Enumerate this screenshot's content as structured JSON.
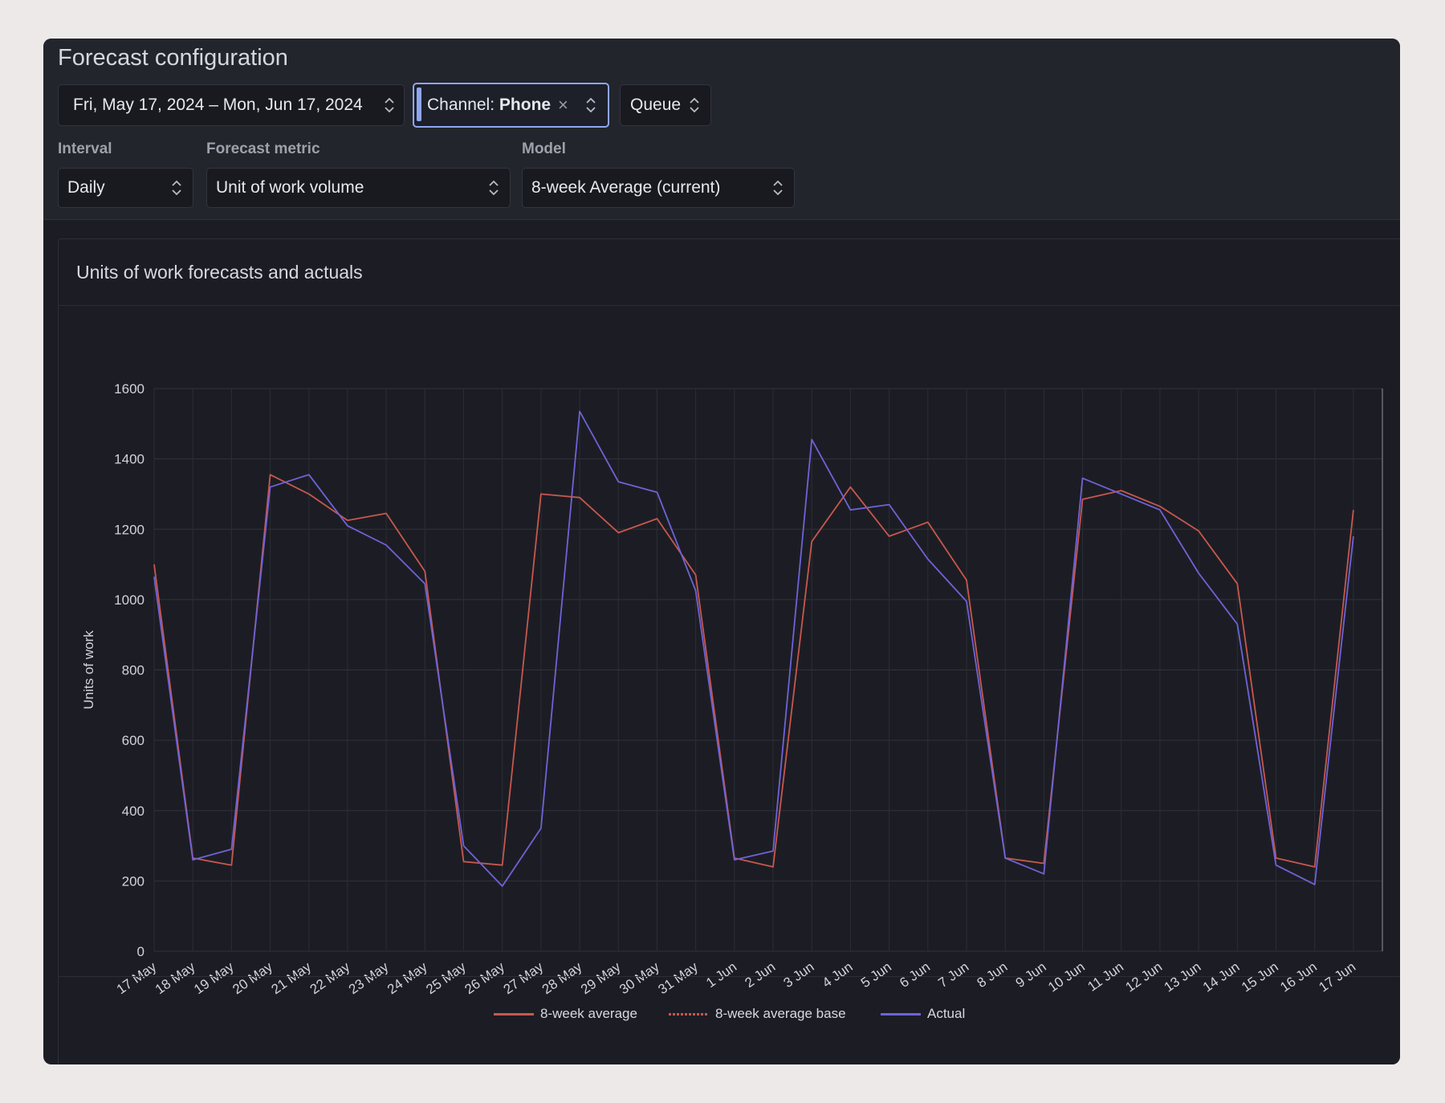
{
  "app": {
    "title": "Forecast configuration"
  },
  "filters": {
    "date_range": "Fri, May 17, 2024 – Mon, Jun 17, 2024",
    "channel_prefix": "Channel: ",
    "channel_value": "Phone",
    "clear_symbol": "×",
    "queue": "Queue"
  },
  "settings": {
    "interval_label": "Interval",
    "interval_value": "Daily",
    "metric_label": "Forecast metric",
    "metric_value": "Unit of work volume",
    "model_label": "Model",
    "model_value": "8-week Average (current)"
  },
  "icons": {
    "chevron": "chevron-up-down-icon",
    "clear": "close-icon"
  },
  "colors": {
    "accent": "#8ea6f2",
    "avg": "#c8574f",
    "actual": "#6e63d8"
  },
  "chart_data": {
    "type": "line",
    "title": "Units of work forecasts and actuals",
    "ylabel": "Units of work",
    "xlabel": "",
    "ylim": [
      0,
      1600
    ],
    "yticks": [
      0,
      200,
      400,
      600,
      800,
      1000,
      1200,
      1400,
      1600
    ],
    "grid": true,
    "legend_position": "bottom",
    "categories": [
      "17 May",
      "18 May",
      "19 May",
      "20 May",
      "21 May",
      "22 May",
      "23 May",
      "24 May",
      "25 May",
      "26 May",
      "27 May",
      "28 May",
      "29 May",
      "30 May",
      "31 May",
      "1 Jun",
      "2 Jun",
      "3 Jun",
      "4 Jun",
      "5 Jun",
      "6 Jun",
      "7 Jun",
      "8 Jun",
      "9 Jun",
      "10 Jun",
      "11 Jun",
      "12 Jun",
      "13 Jun",
      "14 Jun",
      "15 Jun",
      "16 Jun",
      "17 Jun"
    ],
    "series": [
      {
        "name": "8-week average",
        "color": "#c8574f",
        "style": "solid",
        "values": [
          1100,
          265,
          245,
          1355,
          1300,
          1225,
          1245,
          1080,
          255,
          245,
          1300,
          1290,
          1190,
          1230,
          1070,
          265,
          240,
          1165,
          1320,
          1180,
          1220,
          1055,
          265,
          250,
          1285,
          1310,
          1265,
          1195,
          1045,
          265,
          240,
          1255
        ]
      },
      {
        "name": "8-week average base",
        "color": "#c8574f",
        "style": "dotted",
        "values": []
      },
      {
        "name": "Actual",
        "color": "#6e63d8",
        "style": "solid",
        "values": [
          1065,
          260,
          290,
          1320,
          1355,
          1210,
          1155,
          1045,
          300,
          185,
          350,
          1535,
          1335,
          1305,
          1025,
          260,
          285,
          1455,
          1255,
          1270,
          1115,
          995,
          265,
          220,
          1345,
          1300,
          1255,
          1075,
          930,
          245,
          190,
          1180
        ]
      }
    ]
  }
}
